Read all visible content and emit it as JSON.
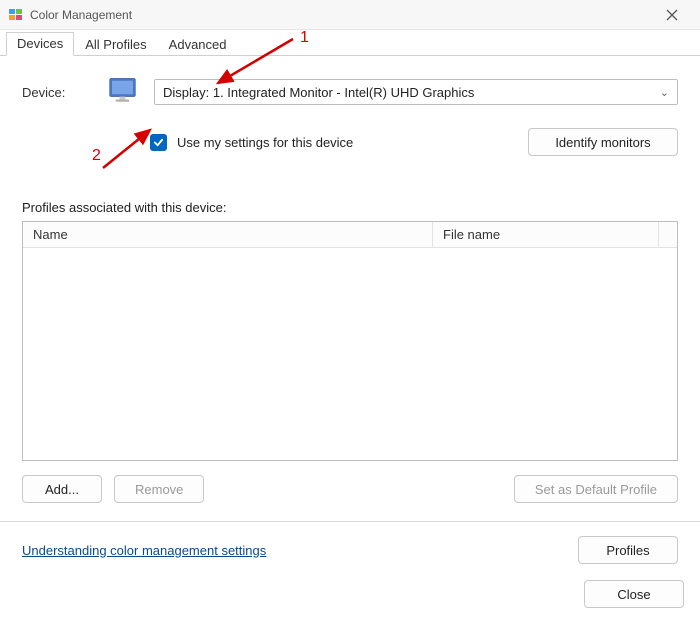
{
  "window": {
    "title": "Color Management"
  },
  "tabs": {
    "devices": "Devices",
    "all_profiles": "All Profiles",
    "advanced": "Advanced"
  },
  "device": {
    "label": "Device:",
    "selected": "Display: 1. Integrated Monitor - Intel(R) UHD Graphics"
  },
  "checkbox": {
    "label": "Use my settings for this device"
  },
  "buttons": {
    "identify": "Identify monitors",
    "add": "Add...",
    "remove": "Remove",
    "set_default": "Set as Default Profile",
    "profiles": "Profiles",
    "close": "Close"
  },
  "profiles_section": {
    "caption": "Profiles associated with this device:",
    "col_name": "Name",
    "col_file": "File name"
  },
  "link": {
    "understanding": "Understanding color management settings"
  },
  "annotations": {
    "one": "1",
    "two": "2"
  }
}
